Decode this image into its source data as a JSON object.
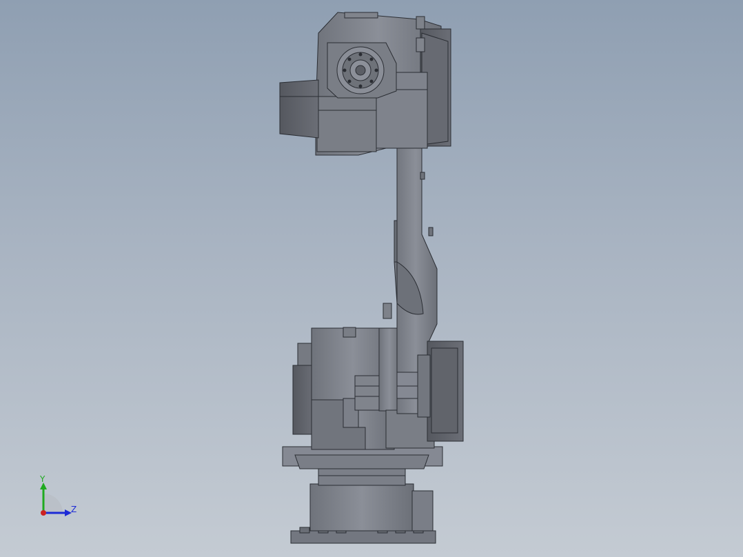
{
  "viewport": {
    "background_top": "#8f9fb2",
    "background_bottom": "#c4cbd3",
    "model": "robot-arm-side-view",
    "model_fill": "#7d8189",
    "model_fill_light": "#8c9099",
    "model_edge": "#2a2d33"
  },
  "triad": {
    "y_label": "Y",
    "z_label": "Z",
    "y_color": "#1faa1f",
    "z_color": "#1d2bd6",
    "x_color": "#cc2222"
  }
}
